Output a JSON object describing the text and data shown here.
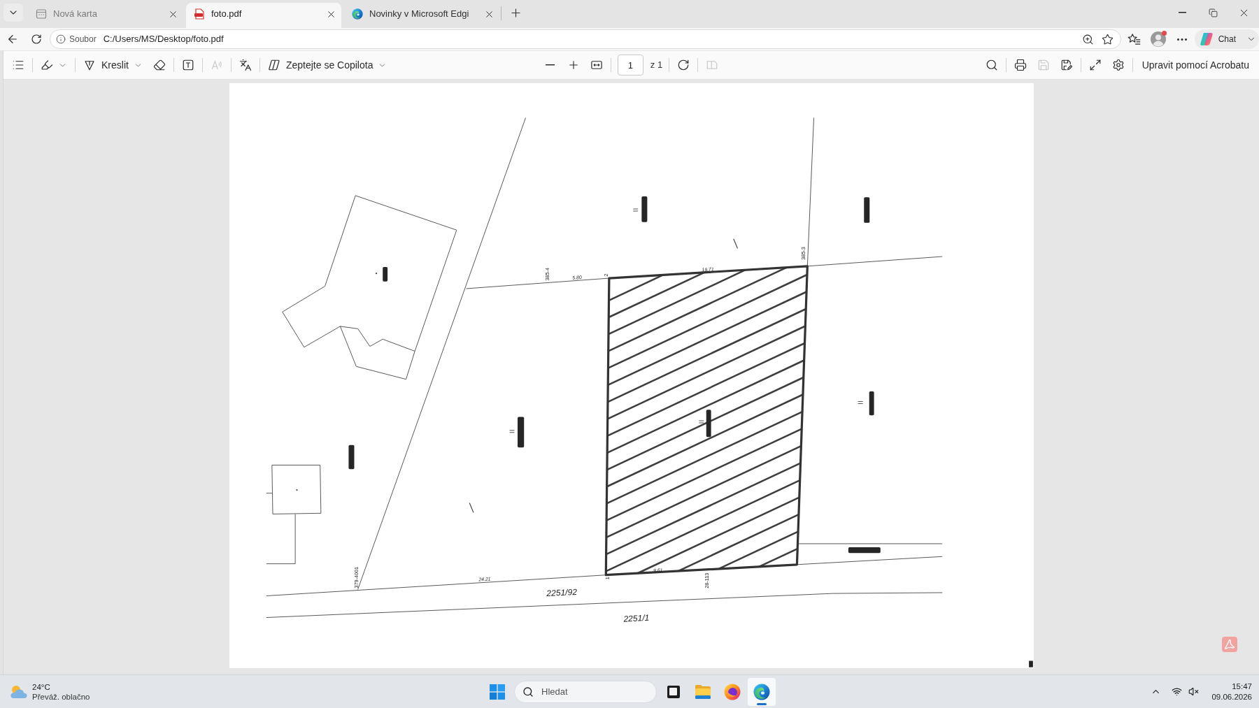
{
  "browser": {
    "tabs": [
      {
        "kind": "new_tab",
        "title": "Nová karta",
        "selected": false
      },
      {
        "kind": "pdf",
        "title": "foto.pdf",
        "selected": true
      },
      {
        "kind": "edge",
        "title": "Novinky v Microsoft Edgi",
        "selected": false
      }
    ],
    "address_bar": {
      "scheme": "Soubor",
      "url": "C:/Users/MS/Desktop/foto.pdf"
    },
    "profile": {
      "notification": true
    },
    "chat_button": {
      "label": "Chat"
    }
  },
  "pdf_toolbar": {
    "left_groups": [
      [
        {
          "kind": "contents",
          "disabled": false
        }
      ],
      [
        {
          "kind": "highlight",
          "disabled": false
        }
      ],
      [
        {
          "kind": "draw",
          "label": "Kreslit",
          "disabled": false
        },
        {
          "kind": "eraser",
          "disabled": false
        }
      ],
      [
        {
          "kind": "text_box",
          "disabled": false
        }
      ],
      [
        {
          "kind": "read_aloud",
          "disabled": true
        }
      ],
      [
        {
          "kind": "translate",
          "disabled": false
        }
      ],
      [
        {
          "kind": "copilot",
          "label": "Zeptejte se Copilota",
          "disabled": false
        }
      ]
    ],
    "center_groups": [
      [
        {
          "kind": "zoom_out",
          "disabled": false
        },
        {
          "kind": "zoom_in",
          "disabled": false
        },
        {
          "kind": "fit_width",
          "disabled": false
        }
      ],
      [
        {
          "kind": "page",
          "value": "1",
          "total": "z 1"
        }
      ],
      [
        {
          "kind": "rotate",
          "disabled": false
        }
      ],
      [
        {
          "kind": "two_page",
          "disabled": true
        }
      ]
    ],
    "right_groups": [
      [
        {
          "kind": "search",
          "disabled": false
        }
      ],
      [
        {
          "kind": "print",
          "disabled": false
        },
        {
          "kind": "save",
          "disabled": true
        },
        {
          "kind": "save_as",
          "disabled": false
        }
      ],
      [
        {
          "kind": "fullscreen",
          "disabled": false
        },
        {
          "kind": "settings",
          "disabled": false
        }
      ],
      [
        {
          "kind": "acrobat",
          "label": "Upravit pomocí Acrobatu",
          "disabled": false
        }
      ]
    ]
  },
  "document": {
    "labels": [
      {
        "kind": "point",
        "text": "385-4"
      },
      {
        "kind": "measure",
        "text": "5.80"
      },
      {
        "kind": "point",
        "text": "2"
      },
      {
        "kind": "measure",
        "text": "19.71"
      },
      {
        "kind": "point",
        "text": "385-3"
      },
      {
        "kind": "point",
        "text": "379-4001"
      },
      {
        "kind": "measure",
        "text": "24.21"
      },
      {
        "kind": "point",
        "text": "1"
      },
      {
        "kind": "measure",
        "text": "9.61"
      },
      {
        "kind": "point",
        "text": "28-113"
      },
      {
        "kind": "parcel",
        "text": "2251/92"
      },
      {
        "kind": "parcel",
        "text": "2251/1"
      }
    ]
  },
  "taskbar": {
    "weather": {
      "temperature": "24°C",
      "condition": "Převáž. oblačno"
    },
    "search": {
      "placeholder": "Hledat"
    },
    "apps": [
      {
        "kind": "task_view",
        "selected": false
      },
      {
        "kind": "file_explorer",
        "selected": false
      },
      {
        "kind": "firefox",
        "selected": false
      },
      {
        "kind": "edge",
        "selected": true
      }
    ],
    "tray": {
      "muted": true
    },
    "clock": {
      "time": "15:47",
      "date": "09.06.2026"
    }
  }
}
